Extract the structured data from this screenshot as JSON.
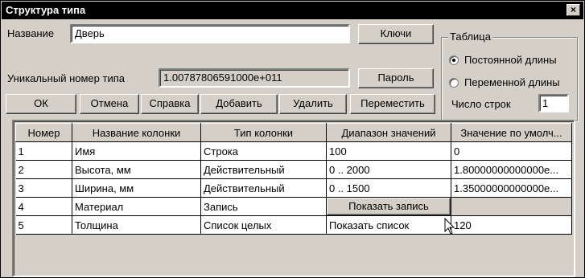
{
  "window": {
    "title": "Структура типа",
    "close_glyph": "×"
  },
  "name_field": {
    "label": "Название",
    "value": "Дверь"
  },
  "id_field": {
    "label": "Уникальный номер типа",
    "value": "1.00787806591000e+011"
  },
  "buttons": {
    "keys": "Ключи",
    "password": "Пароль",
    "ok": "ОК",
    "cancel": "Отмена",
    "help": "Справка",
    "add": "Добавить",
    "delete": "Удалить",
    "move": "Переместить"
  },
  "table_group": {
    "title": "Таблица",
    "fixed_length": "Постоянной длины",
    "variable_length": "Переменной длины",
    "selected": "fixed_length",
    "rows_label": "Число строк",
    "rows_value": "1"
  },
  "grid": {
    "columns": [
      "Номер",
      "Название колонки",
      "Тип колонки",
      "Диапазон значений",
      "Значение по умолч..."
    ],
    "rows": [
      [
        "1",
        "Имя",
        "Строка",
        "100",
        "0"
      ],
      [
        "2",
        "Высота, мм",
        "Действительный",
        "0 .. 2000",
        "1.80000000000000e..."
      ],
      [
        "3",
        "Ширина, мм",
        "Действительный",
        "0 .. 1500",
        "1.35000000000000e..."
      ],
      [
        "4",
        "Материал",
        "Запись",
        "Показать запись",
        ""
      ],
      [
        "5",
        "Толщина",
        "Список целых",
        "Показать список",
        "120"
      ]
    ]
  },
  "colors": {
    "face": "#d4d0c8",
    "titlebar": "#000000",
    "cell": "#ffffff"
  }
}
